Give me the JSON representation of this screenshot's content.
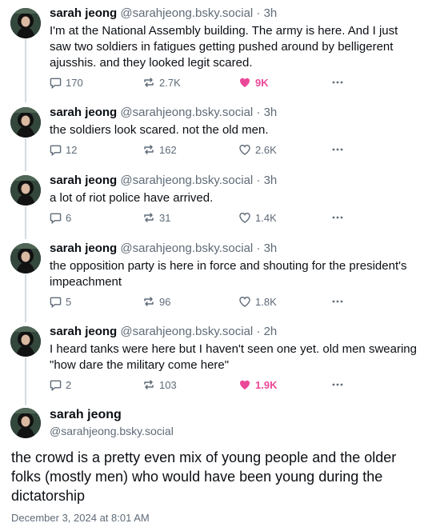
{
  "author": {
    "name": "sarah jeong",
    "handle": "@sarahjeong.bsky.social",
    "avatar": "profile-avatar"
  },
  "colors": {
    "accent_like": "#ec4899",
    "muted": "#5f6b78",
    "thread_line": "#d4dbe2"
  },
  "thread": [
    {
      "time": "3h",
      "separator": "·",
      "text": "I'm at the National Assembly building. The army is here. And I just saw two soldiers in fatigues getting pushed around by belligerent ajusshis. and they looked legit scared.",
      "replies": "170",
      "reposts": "2.7K",
      "likes": "9K",
      "liked": true
    },
    {
      "time": "3h",
      "separator": "·",
      "text": "the soldiers look scared. not the old men.",
      "replies": "12",
      "reposts": "162",
      "likes": "2.6K",
      "liked": false
    },
    {
      "time": "3h",
      "separator": "·",
      "text": "a lot of riot police have arrived.",
      "replies": "6",
      "reposts": "31",
      "likes": "1.4K",
      "liked": false
    },
    {
      "time": "3h",
      "separator": "·",
      "text": "the opposition party is here in force and shouting for the president's impeachment",
      "replies": "5",
      "reposts": "96",
      "likes": "1.8K",
      "liked": false
    },
    {
      "time": "2h",
      "separator": "·",
      "text": "I heard tanks were here but I haven't seen one yet. old men swearing \"how dare the military come here\"",
      "replies": "2",
      "reposts": "103",
      "likes": "1.9K",
      "liked": true
    }
  ],
  "main_post": {
    "text": "the crowd is a pretty even mix of young people and the older folks (mostly men) who would have been young during the dictatorship",
    "date": "December 3, 2024 at 8:01 AM"
  }
}
